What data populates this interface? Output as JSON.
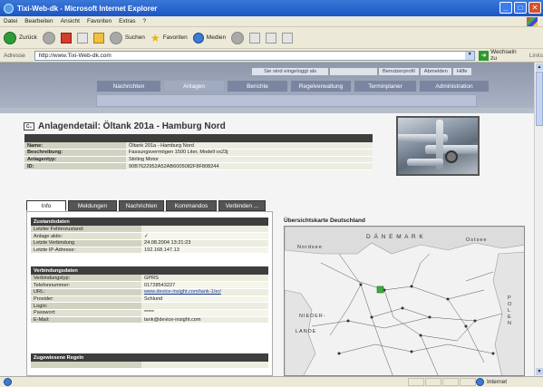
{
  "window": {
    "title": "Tixi-Web-dk - Microsoft Internet Explorer",
    "min": "_",
    "max": "□",
    "close": "✕"
  },
  "menu": [
    "Datei",
    "Bearbeiten",
    "Ansicht",
    "Favoriten",
    "Extras",
    "?"
  ],
  "toolbar": {
    "back": "Zurück",
    "search": "Suchen",
    "favorites": "Favoriten",
    "media": "Medien"
  },
  "address": {
    "label": "Adresse",
    "url": "http://www.Tixi-Web-dk.com",
    "go": "Wechseln zu",
    "links": "Links"
  },
  "site": {
    "logged_in": "Sie sind eingeloggt als",
    "user_name": "",
    "profile": "Benutzerprofil",
    "logout": "Abmelden",
    "help": "Hilfe",
    "nav": [
      "Nachrichten",
      "Anlagen",
      "Berichte",
      "Regelverwaltung",
      "Terminplaner",
      "Administration"
    ],
    "nav_active": 1
  },
  "detail": {
    "icon_text": "C₃",
    "title": "Anlagendetail: Öltank 201a - Hamburg Nord",
    "rows": [
      {
        "k": "Name:",
        "v": "Öltank 201a - Hamburg Nord"
      },
      {
        "k": "Beschreibung:",
        "v": "Fassungsvermögen 1500 Liter, Modell vx23j"
      },
      {
        "k": "Anlagentyp:",
        "v": "Stirling Motor"
      },
      {
        "k": "ID:",
        "v": "90B7622952A52AB6005082F8F808244"
      }
    ]
  },
  "tabs": [
    "Info",
    "Meldungen",
    "Nachrichten",
    "Kommandos",
    "Verbinden ..."
  ],
  "tabs_active": 0,
  "zustand": {
    "header": "Zustandsdaten",
    "rows": [
      {
        "k": "Letzter Fehlerzustand:",
        "v": ""
      },
      {
        "k": "Anlage aktiv:",
        "v": "✓"
      },
      {
        "k": "Letzte Verbindung",
        "v": "24.08.2004 13:21:23"
      },
      {
        "k": "Letzte IP-Adresse:",
        "v": "192.168.147.13"
      }
    ]
  },
  "verbindung": {
    "header": "Verbindungsdaten",
    "rows": [
      {
        "k": "Verbindungstyp:",
        "v": "GPRS"
      },
      {
        "k": "Telefonnummer:",
        "v": "01728543227"
      },
      {
        "k": "URL:",
        "v": "www.device-insight.com/tank-1/er/",
        "link": true
      },
      {
        "k": "Provider:",
        "v": "Schlund"
      },
      {
        "k": "Login:",
        "v": ""
      },
      {
        "k": "Passwort:",
        "v": "*****"
      },
      {
        "k": "E-Mail:",
        "v": "tank@device-insight.com"
      }
    ]
  },
  "regeln": {
    "header": "Zugewiesene Regeln"
  },
  "map": {
    "title": "Übersichtskarte Deutschland",
    "labels": [
      "D Ä N E M A R K",
      "Nordsee",
      "Ostsee",
      "NIEDER-",
      "LANDE",
      "P O L E N"
    ]
  },
  "status": {
    "zone": "Internet"
  }
}
